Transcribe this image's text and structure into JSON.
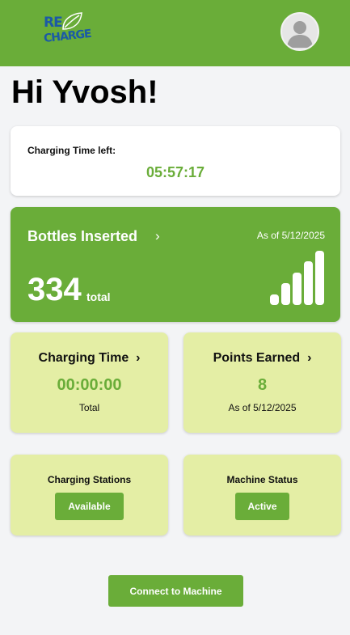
{
  "header": {
    "logo_top": "RE",
    "logo_bottom": "CHARGE",
    "logo_icon": "leaf-icon",
    "avatar_icon": "user-avatar-icon"
  },
  "greeting": "Hi Yvosh!",
  "charging_time_left": {
    "label": "Charging Time left:",
    "value": "05:57:17"
  },
  "bottles": {
    "title": "Bottles Inserted",
    "chevron": "›",
    "as_of": "As of 5/12/2025",
    "count": "334",
    "unit": "total",
    "icon": "signal-bars-icon"
  },
  "charging_time": {
    "title": "Charging Time",
    "chevron": "›",
    "value": "00:00:00",
    "sub": "Total"
  },
  "points": {
    "title": "Points Earned",
    "chevron": "›",
    "value": "8",
    "sub": "As of 5/12/2025"
  },
  "stations": {
    "title": "Charging Stations",
    "status": "Available"
  },
  "machine": {
    "title": "Machine Status",
    "status": "Active"
  },
  "connect_button": "Connect to Machine",
  "colors": {
    "brand_green": "#6aad39",
    "light_card": "#e4eea5",
    "logo_blue": "#1b5aa6",
    "background": "#f3f4f6"
  }
}
